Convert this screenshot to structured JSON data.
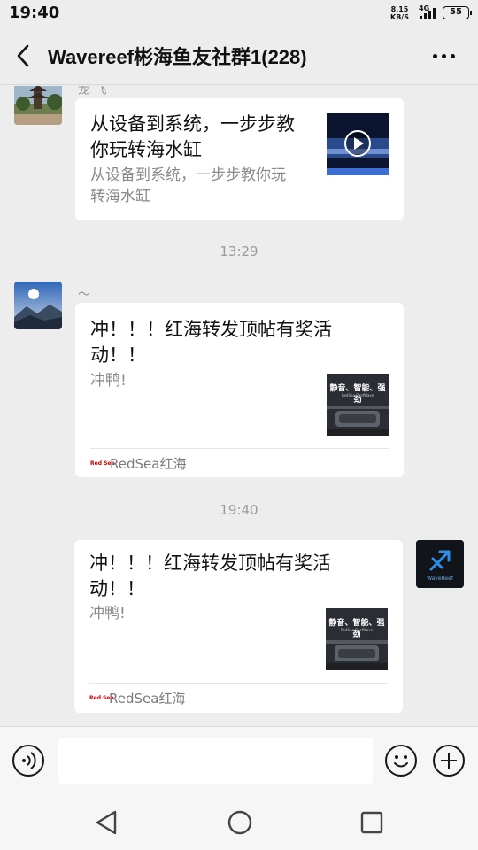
{
  "status_bar": {
    "time": "19:40",
    "net_speed": "8.15",
    "net_speed_unit": "KB/S",
    "network_type": "4G",
    "battery": "55"
  },
  "header": {
    "title": "Wavereef彬海鱼友社群1(228)",
    "back_icon": "chevron-left-icon",
    "more_icon": "more-dots-icon"
  },
  "messages": [
    {
      "sender_name": "龙 飞",
      "avatar_icon": "pagoda-photo-avatar",
      "card_title_lines": [
        "从设备到系统，一步步教",
        "你玩转海水缸"
      ],
      "card_desc_lines": [
        "从设备到系统，一步步教你玩",
        "转海水缸"
      ],
      "thumb_icon": "video-play-thumbnail"
    },
    {
      "timestamp": "13:29"
    },
    {
      "sender_name": "～",
      "avatar_icon": "mountain-sunrise-avatar",
      "card_title_lines": [
        "冲！！！红海转发顶帖有奖活",
        "动！！"
      ],
      "card_desc": "冲鸭!",
      "thumb_text": "静音、智能、强劲",
      "thumb_subtext": "RedSea ReefWave",
      "source_logo_text": "Red Sea",
      "source_name": "RedSea红海"
    },
    {
      "timestamp": "19:40"
    },
    {
      "sender_name": "",
      "avatar_icon": "sagittarius-logo-avatar",
      "avatar_caption": "WaveReef",
      "card_title_lines": [
        "冲！！！红海转发顶帖有奖活",
        "动！！"
      ],
      "card_desc": "冲鸭!",
      "thumb_text": "静音、智能、强劲",
      "thumb_subtext": "RedSea ReefWave",
      "source_logo_text": "Red Sea",
      "source_name": "RedSea红海"
    }
  ],
  "input_bar": {
    "value": "",
    "voice_icon": "voice-icon",
    "emoji_icon": "emoji-icon",
    "plus_icon": "plus-icon"
  },
  "nav_bar": {
    "back_icon": "triangle-back-icon",
    "home_icon": "circle-home-icon",
    "recents_icon": "square-recents-icon"
  }
}
